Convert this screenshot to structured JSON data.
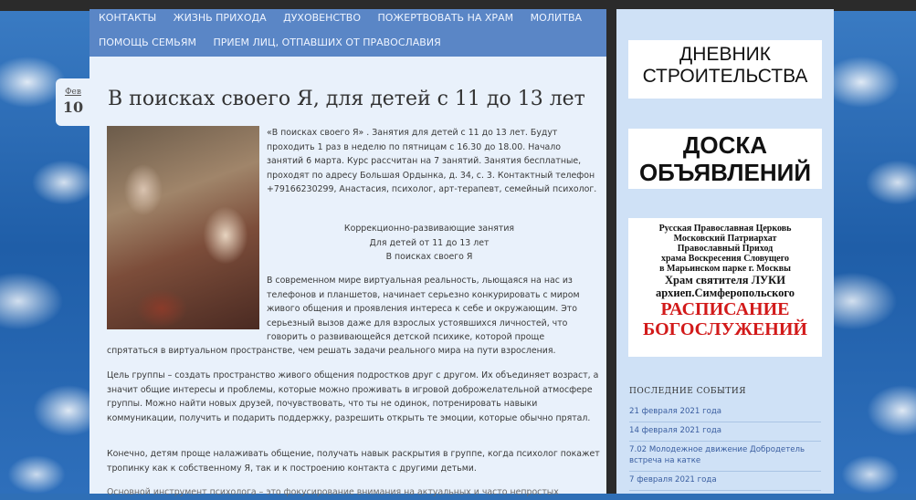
{
  "nav": {
    "row1": [
      "КОНТАКТЫ",
      "ЖИЗНЬ ПРИХОДА",
      "ДУХОВЕНСТВО",
      "ПОЖЕРТВОВАТЬ НА ХРАМ",
      "МОЛИТВА"
    ],
    "row2": [
      "ПОМОЩЬ СЕМЬЯМ",
      "ПРИЕМ ЛИЦ, ОТПАВШИХ ОТ ПРАВОСЛАВИЯ"
    ]
  },
  "post": {
    "month": "Фев",
    "day": "10",
    "title": "В поисках своего Я, для детей с 11 до 13 лет",
    "intro": "«В поисках своего Я» . Занятия для детей с 11 до 13 лет. Будут проходить 1 раз в неделю по пятницам с 16.30 до 18.00. Начало занятий 6 марта. Курс рассчитан на 7 занятий. Занятия бесплатные, проходят по адресу Большая Ордынка, д. 34, с. 3. Контактный телефон +79166230299, Анастасия, психолог, арт-терапевт, семейный психолог.",
    "center_lines": [
      "Коррекционно-развивающие занятия",
      "Для детей от 11 до 13 лет",
      "В поисках своего Я"
    ],
    "para3a": "В современном мире виртуальная реальность, льющаяся на нас из телефонов и планшетов, начинает серьезно конкурировать с миром живого общения и проявления интереса к себе и окружающим. Это серьезный вызов даже для взрослых устоявшихся личностей, что говорить о развивающейся детской психике, которой проще",
    "para3b": "спрятаться в виртуальном пространстве, чем решать задачи реального мира на пути взросления.",
    "para4": "Цель группы – создать пространство живого общения подростков друг с другом. Их объединяет возраст, а значит общие интересы и проблемы, которые можно проживать в игровой доброжелательной атмосфере группы. Можно найти новых друзей, почувствовать, что ты не одинок, потренировать навыки коммуникации, получить и подарить поддержку, разрешить открыть те эмоции, которые обычно прятал.",
    "para5": "Конечно, детям проще налаживать общение, получать навык раскрытия в группе, когда психолог покажет тропинку как к собственному Я, так и к построению контакта с другими детьми.",
    "para6": "Основной инструмент психолога – это фокусирование внимания на актуальных и часто непростых"
  },
  "sidebar": {
    "box1": [
      "ДНЕВНИК",
      "СТРОИТЕЛЬСТВА"
    ],
    "box2": [
      "ДОСКА",
      "ОБЪЯВЛЕНИЙ"
    ],
    "box3_small": [
      "Русская Православная Церковь",
      "Московский Патриархат",
      "Православный Приход",
      "храма Воскресения Словущего",
      "в Марьинском парке  г. Москвы"
    ],
    "box3_mid": [
      "Храм святителя ЛУКИ",
      "архиеп.Симферопольского"
    ],
    "box3_red": [
      "РАСПИСАНИЕ",
      "БОГОСЛУЖЕНИЙ"
    ],
    "events_heading": "ПОСЛЕДНИЕ СОБЫТИЯ",
    "events": [
      "21 февраля 2021 года",
      "14 февраля 2021 года",
      "7.02 Молодежное движение Добродетель встреча на катке",
      "7 февраля 2021 года"
    ]
  }
}
